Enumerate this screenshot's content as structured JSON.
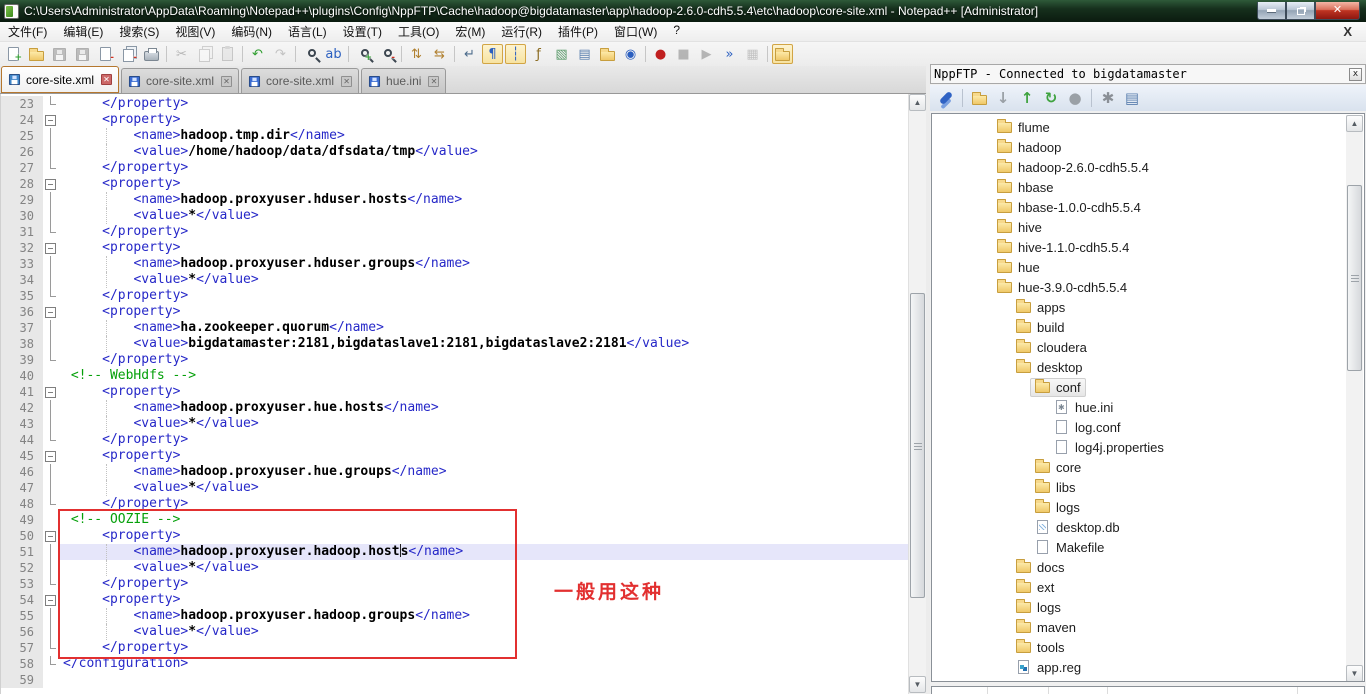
{
  "window": {
    "title": "C:\\Users\\Administrator\\AppData\\Roaming\\Notepad++\\plugins\\Config\\NppFTP\\Cache\\hadoop@bigdatamaster\\app\\hadoop-2.6.0-cdh5.5.4\\etc\\hadoop\\core-site.xml - Notepad++ [Administrator]",
    "buttons": [
      "minimize",
      "restore",
      "close"
    ]
  },
  "menu": {
    "items": [
      "文件(F)",
      "编辑(E)",
      "搜索(S)",
      "视图(V)",
      "编码(N)",
      "语言(L)",
      "设置(T)",
      "工具(O)",
      "宏(M)",
      "运行(R)",
      "插件(P)",
      "窗口(W)",
      "?"
    ],
    "close_label": "X"
  },
  "toolbar": {
    "icons": [
      {
        "name": "new-file",
        "shape": "page",
        "badge": "+",
        "badge_color": "#2f9e2f"
      },
      {
        "name": "open-file",
        "shape": "folder"
      },
      {
        "name": "save-file",
        "shape": "floppy",
        "state": "disabled"
      },
      {
        "name": "save-all",
        "shape": "floppy",
        "state": "disabled"
      },
      {
        "name": "close-file",
        "shape": "page",
        "badge": "-",
        "badge_color": "#d03020"
      },
      {
        "name": "close-all",
        "shape": "page2",
        "badge": "-",
        "badge_color": "#d03020"
      },
      {
        "name": "print",
        "shape": "printer"
      },
      {
        "sep": true
      },
      {
        "name": "cut",
        "glyph": "✂",
        "color": "#555",
        "state": "disabled"
      },
      {
        "name": "copy",
        "shape": "page2",
        "state": "disabled"
      },
      {
        "name": "paste",
        "shape": "clipboard",
        "state": "disabled"
      },
      {
        "sep": true
      },
      {
        "name": "undo",
        "glyph": "↶",
        "color": "#2f9e2f"
      },
      {
        "name": "redo",
        "glyph": "↷",
        "color": "#777",
        "state": "disabled"
      },
      {
        "sep": true
      },
      {
        "name": "find",
        "shape": "magnifier"
      },
      {
        "name": "replace",
        "glyph": "ab",
        "color": "#2b5fc0"
      },
      {
        "sep": true
      },
      {
        "name": "zoom-in",
        "shape": "magnifier",
        "badge": "+",
        "badge_color": "#2f9e2f"
      },
      {
        "name": "zoom-out",
        "shape": "magnifier",
        "badge": "-",
        "badge_color": "#d03020"
      },
      {
        "sep": true
      },
      {
        "name": "sync-scroll-vertical",
        "glyph": "⇅",
        "color": "#b08030"
      },
      {
        "name": "sync-scroll-horizontal",
        "glyph": "⇆",
        "color": "#b08030"
      },
      {
        "sep": true
      },
      {
        "name": "word-wrap",
        "glyph": "↵",
        "color": "#4a6a8a"
      },
      {
        "name": "show-all-characters",
        "glyph": "¶",
        "color": "#2b5fc0",
        "state": "pressed"
      },
      {
        "name": "indent-guide",
        "glyph": "┆",
        "color": "#2b5fc0",
        "state": "pressed"
      },
      {
        "name": "function-list",
        "glyph": "ƒ",
        "color": "#8a6a20"
      },
      {
        "name": "document-map",
        "glyph": "▧",
        "color": "#5a9a6a"
      },
      {
        "name": "document-list",
        "glyph": "▤",
        "color": "#5a7fae"
      },
      {
        "name": "folder-as-workspace",
        "shape": "folder"
      },
      {
        "name": "document-monitor",
        "glyph": "◉",
        "color": "#2b5fc0"
      },
      {
        "sep": true
      },
      {
        "name": "macro-record",
        "glyph": "●",
        "color": "#c02020"
      },
      {
        "name": "macro-stop",
        "glyph": "■",
        "color": "#555",
        "state": "disabled"
      },
      {
        "name": "macro-play",
        "glyph": "▶",
        "color": "#555",
        "state": "disabled"
      },
      {
        "name": "macro-run-multiple",
        "glyph": "»",
        "color": "#2b5fc0"
      },
      {
        "name": "macro-save",
        "glyph": "▦",
        "color": "#777",
        "state": "disabled"
      },
      {
        "sep": true
      },
      {
        "name": "show-nppftp-window",
        "shape": "folder",
        "state": "pressed"
      }
    ]
  },
  "tabs": [
    {
      "label": "core-site.xml",
      "active": true
    },
    {
      "label": "core-site.xml",
      "active": false
    },
    {
      "label": "core-site.xml",
      "active": false
    },
    {
      "label": "hue.ini",
      "active": false
    }
  ],
  "editor": {
    "colors": {
      "tag": "#2628c8",
      "text": "#000000",
      "comment": "#05a00a",
      "caret_line": "#e6e6fa",
      "annotation": "#e23030"
    },
    "annotation": {
      "text": "一般用这种"
    },
    "lines": [
      {
        "n": 23,
        "f": "end",
        "i": 5,
        "t": [
          [
            "tag",
            "</property>"
          ]
        ]
      },
      {
        "n": 24,
        "f": "open",
        "i": 5,
        "t": [
          [
            "tag",
            "<property>"
          ]
        ]
      },
      {
        "n": 25,
        "f": "mid",
        "i": 9,
        "t": [
          [
            "tag",
            "<name>"
          ],
          [
            "txt",
            "hadoop.tmp.dir"
          ],
          [
            "tag",
            "</name>"
          ]
        ]
      },
      {
        "n": 26,
        "f": "mid",
        "i": 9,
        "t": [
          [
            "tag",
            "<value>"
          ],
          [
            "txt",
            "/home/hadoop/data/dfsdata/tmp"
          ],
          [
            "tag",
            "</value>"
          ]
        ]
      },
      {
        "n": 27,
        "f": "end",
        "i": 5,
        "t": [
          [
            "tag",
            "</property>"
          ]
        ]
      },
      {
        "n": 28,
        "f": "open",
        "i": 5,
        "t": [
          [
            "tag",
            "<property>"
          ]
        ]
      },
      {
        "n": 29,
        "f": "mid",
        "i": 9,
        "t": [
          [
            "tag",
            "<name>"
          ],
          [
            "txt",
            "hadoop.proxyuser.hduser.hosts"
          ],
          [
            "tag",
            "</name>"
          ]
        ]
      },
      {
        "n": 30,
        "f": "mid",
        "i": 9,
        "t": [
          [
            "tag",
            "<value>"
          ],
          [
            "txt",
            "*"
          ],
          [
            "tag",
            "</value>"
          ]
        ]
      },
      {
        "n": 31,
        "f": "end",
        "i": 5,
        "t": [
          [
            "tag",
            "</property>"
          ]
        ]
      },
      {
        "n": 32,
        "f": "open",
        "i": 5,
        "t": [
          [
            "tag",
            "<property>"
          ]
        ]
      },
      {
        "n": 33,
        "f": "mid",
        "i": 9,
        "t": [
          [
            "tag",
            "<name>"
          ],
          [
            "txt",
            "hadoop.proxyuser.hduser.groups"
          ],
          [
            "tag",
            "</name>"
          ]
        ]
      },
      {
        "n": 34,
        "f": "mid",
        "i": 9,
        "t": [
          [
            "tag",
            "<value>"
          ],
          [
            "txt",
            "*"
          ],
          [
            "tag",
            "</value>"
          ]
        ]
      },
      {
        "n": 35,
        "f": "end",
        "i": 5,
        "t": [
          [
            "tag",
            "</property>"
          ]
        ]
      },
      {
        "n": 36,
        "f": "open",
        "i": 5,
        "t": [
          [
            "tag",
            "<property>"
          ]
        ]
      },
      {
        "n": 37,
        "f": "mid",
        "i": 9,
        "t": [
          [
            "tag",
            "<name>"
          ],
          [
            "txt",
            "ha.zookeeper.quorum"
          ],
          [
            "tag",
            "</name>"
          ]
        ]
      },
      {
        "n": 38,
        "f": "mid",
        "i": 9,
        "t": [
          [
            "tag",
            "<value>"
          ],
          [
            "txt",
            "bigdatamaster:2181,bigdataslave1:2181,bigdataslave2:2181"
          ],
          [
            "tag",
            "</value>"
          ]
        ]
      },
      {
        "n": 39,
        "f": "end",
        "i": 5,
        "t": [
          [
            "tag",
            "</property>"
          ]
        ]
      },
      {
        "n": 40,
        "f": "none",
        "i": 1,
        "t": [
          [
            "com",
            "<!-- WebHdfs -->"
          ]
        ]
      },
      {
        "n": 41,
        "f": "open",
        "i": 5,
        "t": [
          [
            "tag",
            "<property>"
          ]
        ]
      },
      {
        "n": 42,
        "f": "mid",
        "i": 9,
        "t": [
          [
            "tag",
            "<name>"
          ],
          [
            "txt",
            "hadoop.proxyuser.hue.hosts"
          ],
          [
            "tag",
            "</name>"
          ]
        ]
      },
      {
        "n": 43,
        "f": "mid",
        "i": 9,
        "t": [
          [
            "tag",
            "<value>"
          ],
          [
            "txt",
            "*"
          ],
          [
            "tag",
            "</value>"
          ]
        ]
      },
      {
        "n": 44,
        "f": "end",
        "i": 5,
        "t": [
          [
            "tag",
            "</property>"
          ]
        ]
      },
      {
        "n": 45,
        "f": "open",
        "i": 5,
        "t": [
          [
            "tag",
            "<property>"
          ]
        ]
      },
      {
        "n": 46,
        "f": "mid",
        "i": 9,
        "t": [
          [
            "tag",
            "<name>"
          ],
          [
            "txt",
            "hadoop.proxyuser.hue.groups"
          ],
          [
            "tag",
            "</name>"
          ]
        ]
      },
      {
        "n": 47,
        "f": "mid",
        "i": 9,
        "t": [
          [
            "tag",
            "<value>"
          ],
          [
            "txt",
            "*"
          ],
          [
            "tag",
            "</value>"
          ]
        ]
      },
      {
        "n": 48,
        "f": "end",
        "i": 5,
        "t": [
          [
            "tag",
            "</property>"
          ]
        ]
      },
      {
        "n": 49,
        "f": "none",
        "i": 1,
        "t": [
          [
            "com",
            "<!-- OOZIE -->"
          ]
        ]
      },
      {
        "n": 50,
        "f": "open",
        "i": 5,
        "t": [
          [
            "tag",
            "<property>"
          ]
        ]
      },
      {
        "n": 51,
        "f": "mid",
        "i": 9,
        "hl": true,
        "t": [
          [
            "tag",
            "<name>"
          ],
          [
            "txt",
            "hadoop.proxyuser.hadoop.host"
          ],
          [
            "caret",
            ""
          ],
          [
            "txt",
            "s"
          ],
          [
            "tag",
            "</name>"
          ]
        ]
      },
      {
        "n": 52,
        "f": "mid",
        "i": 9,
        "t": [
          [
            "tag",
            "<value>"
          ],
          [
            "txt",
            "*"
          ],
          [
            "tag",
            "</value>"
          ]
        ]
      },
      {
        "n": 53,
        "f": "end",
        "i": 5,
        "t": [
          [
            "tag",
            "</property>"
          ]
        ]
      },
      {
        "n": 54,
        "f": "open",
        "i": 5,
        "t": [
          [
            "tag",
            "<property>"
          ]
        ]
      },
      {
        "n": 55,
        "f": "mid",
        "i": 9,
        "t": [
          [
            "tag",
            "<name>"
          ],
          [
            "txt",
            "hadoop.proxyuser.hadoop.groups"
          ],
          [
            "tag",
            "</name>"
          ]
        ]
      },
      {
        "n": 56,
        "f": "mid",
        "i": 9,
        "t": [
          [
            "tag",
            "<value>"
          ],
          [
            "txt",
            "*"
          ],
          [
            "tag",
            "</value>"
          ]
        ]
      },
      {
        "n": 57,
        "f": "end",
        "i": 5,
        "t": [
          [
            "tag",
            "</property>"
          ]
        ]
      },
      {
        "n": 58,
        "f": "end",
        "i": 0,
        "t": [
          [
            "tag",
            "</configuration>"
          ]
        ]
      },
      {
        "n": 59,
        "f": "none",
        "i": 0,
        "t": []
      }
    ]
  },
  "nppftp": {
    "header": {
      "title": "NppFTP - Connected to bigdatamaster",
      "close_label": "x"
    },
    "toolbar": [
      {
        "name": "connect",
        "shape": "connect"
      },
      {
        "sep": true
      },
      {
        "name": "open-cache-folder",
        "shape": "folder"
      },
      {
        "name": "download-file",
        "glyph": "↓",
        "color": "#9aa0a6"
      },
      {
        "name": "upload-file",
        "glyph": "↑",
        "color": "#3fa33f"
      },
      {
        "name": "refresh",
        "glyph": "↻",
        "color": "#3fa33f"
      },
      {
        "name": "abort",
        "glyph": "●",
        "color": "#9aa0a6"
      },
      {
        "sep": true
      },
      {
        "name": "settings",
        "glyph": "✱",
        "color": "#8a8f96"
      },
      {
        "name": "messages-window",
        "glyph": "▤",
        "color": "#5a7fae"
      }
    ],
    "tree": [
      {
        "label": "flume",
        "level": 1,
        "icon": "folder"
      },
      {
        "label": "hadoop",
        "level": 1,
        "icon": "folder"
      },
      {
        "label": "hadoop-2.6.0-cdh5.5.4",
        "level": 1,
        "icon": "folder"
      },
      {
        "label": "hbase",
        "level": 1,
        "icon": "folder"
      },
      {
        "label": "hbase-1.0.0-cdh5.5.4",
        "level": 1,
        "icon": "folder"
      },
      {
        "label": "hive",
        "level": 1,
        "icon": "folder"
      },
      {
        "label": "hive-1.1.0-cdh5.5.4",
        "level": 1,
        "icon": "folder"
      },
      {
        "label": "hue",
        "level": 1,
        "icon": "folder"
      },
      {
        "label": "hue-3.9.0-cdh5.5.4",
        "level": 1,
        "icon": "folder"
      },
      {
        "label": "apps",
        "level": 2,
        "icon": "folder"
      },
      {
        "label": "build",
        "level": 2,
        "icon": "folder"
      },
      {
        "label": "cloudera",
        "level": 2,
        "icon": "folder"
      },
      {
        "label": "desktop",
        "level": 2,
        "icon": "folder"
      },
      {
        "label": "conf",
        "level": 3,
        "icon": "folder",
        "selected": true
      },
      {
        "label": "hue.ini",
        "level": 4,
        "icon": "file-ini"
      },
      {
        "label": "log.conf",
        "level": 4,
        "icon": "file"
      },
      {
        "label": "log4j.properties",
        "level": 4,
        "icon": "file"
      },
      {
        "label": "core",
        "level": 3,
        "icon": "folder"
      },
      {
        "label": "libs",
        "level": 3,
        "icon": "folder"
      },
      {
        "label": "logs",
        "level": 3,
        "icon": "folder"
      },
      {
        "label": "desktop.db",
        "level": 3,
        "icon": "file-db"
      },
      {
        "label": "Makefile",
        "level": 3,
        "icon": "file"
      },
      {
        "label": "docs",
        "level": 2,
        "icon": "folder"
      },
      {
        "label": "ext",
        "level": 2,
        "icon": "folder"
      },
      {
        "label": "logs",
        "level": 2,
        "icon": "folder"
      },
      {
        "label": "maven",
        "level": 2,
        "icon": "folder"
      },
      {
        "label": "tools",
        "level": 2,
        "icon": "folder"
      },
      {
        "label": "app.reg",
        "level": 2,
        "icon": "file-reg"
      }
    ],
    "queue_strip": {
      "dividers": [
        55,
        116,
        175,
        365
      ]
    }
  }
}
